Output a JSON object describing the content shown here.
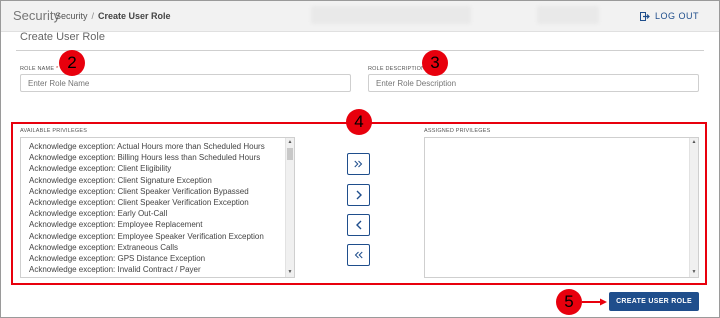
{
  "header": {
    "brand": "Security",
    "breadcrumb": [
      "Security",
      "Create User Role"
    ],
    "logout_label": "LOG OUT"
  },
  "page": {
    "title": "Create User Role"
  },
  "form": {
    "role_name": {
      "label": "ROLE NAME",
      "required_mark": "*",
      "placeholder": "Enter Role Name",
      "value": ""
    },
    "role_description": {
      "label": "ROLE DESCRIPTION",
      "placeholder": "Enter Role Description",
      "value": ""
    }
  },
  "privileges": {
    "available_label": "AVAILABLE PRIVILEGES",
    "assigned_label": "ASSIGNED PRIVILEGES",
    "available": [
      "Acknowledge exception: Actual Hours more than Scheduled Hours",
      "Acknowledge exception: Billing Hours less than Scheduled Hours",
      "Acknowledge exception: Client Eligibility",
      "Acknowledge exception: Client Signature Exception",
      "Acknowledge exception: Client Speaker Verification Bypassed",
      "Acknowledge exception: Client Speaker Verification Exception",
      "Acknowledge exception: Early Out-Call",
      "Acknowledge exception: Employee Replacement",
      "Acknowledge exception: Employee Speaker Verification Exception",
      "Acknowledge exception: Extraneous Calls",
      "Acknowledge exception: GPS Distance Exception",
      "Acknowledge exception: Invalid Contract / Payer"
    ],
    "assigned": [],
    "move_buttons": {
      "move_all_right": "»",
      "move_right": "›",
      "move_left": "‹",
      "move_all_left": "«"
    }
  },
  "actions": {
    "create_label": "CREATE USER ROLE"
  },
  "callouts": [
    "2",
    "3",
    "4",
    "5"
  ],
  "colors": {
    "accent": "#1f4e8c",
    "callout": "#e8000d"
  }
}
